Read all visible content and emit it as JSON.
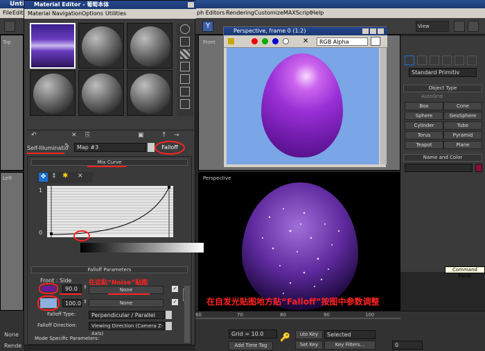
{
  "app": {
    "title_fragment": "Untit",
    "menu": [
      {
        "label": "File"
      },
      {
        "label": "Edit"
      },
      {
        "label": "ph Editors"
      },
      {
        "label": "Rendering"
      },
      {
        "label": "Customize"
      },
      {
        "label": "MAXScript"
      },
      {
        "label": "Help"
      }
    ],
    "toolbar": {
      "view_dropdown": "View",
      "axis_y": "Y"
    },
    "viewport_labels": {
      "top": "Top",
      "left": "Left",
      "front": "Front",
      "perspective": "Perspective"
    },
    "status": {
      "none": "None",
      "render": "Rende",
      "grid": "Grid = 10.0",
      "add_time_tag": "Add Time Tag",
      "auto_key": "uto Key",
      "set_key": "Set Key",
      "selected": "Selected",
      "key_filters": "Key Filters...",
      "frame": "0"
    },
    "timeline_ticks": [
      "60",
      "70",
      "80",
      "90",
      "100"
    ]
  },
  "command_panel": {
    "dropdown": "Standard Primitiv",
    "object_type": "Object Type",
    "autogrid": "AutoGrid",
    "buttons": [
      "Box",
      "Cone",
      "Sphere",
      "GeoSphere",
      "Cylinder",
      "Tube",
      "Torus",
      "Pyramid",
      "Teapot",
      "Plane"
    ],
    "name_and_color": "Name and Color",
    "tooltip": "Command Panel"
  },
  "material_editor": {
    "title": "Material Editor - 葡萄本体",
    "menu": [
      "Material",
      "Navigation",
      "Options",
      "Utilities"
    ],
    "map_label": "Self-Illuminatio",
    "map_name": "Map #3",
    "map_type": "Falloff",
    "mix_curve": {
      "title": "Mix Curve",
      "y_top": "1",
      "y_bottom": "0"
    },
    "falloff_params": {
      "title": "Falloff Parameters",
      "front_side": "Front : Side",
      "value1": "90.0",
      "value2": "100.0",
      "map1": "None",
      "map2": "None",
      "falloff_type_label": "Falloff Type:",
      "falloff_type": "Perpendicular / Parallel",
      "falloff_direction_label": "Falloff Direction:",
      "falloff_direction": "Viewing Direction (Camera Z-Axis)"
    },
    "mode_specific": "Mode Specific Parameters:"
  },
  "render_frame": {
    "title": "Perspective, frame 0 (1:2)",
    "channel": "RGB Alpha"
  },
  "annotations": {
    "noise_note": "在这贴“Noise”贴图",
    "main_note": "在自发光贴图地方贴“Falloff”按图中参数调整"
  },
  "colors": {
    "annotation_red": "#ff2222",
    "egg_purple": "#8a2be2",
    "swatch_front": "#6a1a9a",
    "swatch_side": "#8fb0dc",
    "render_bg": "#7aa5e6"
  }
}
